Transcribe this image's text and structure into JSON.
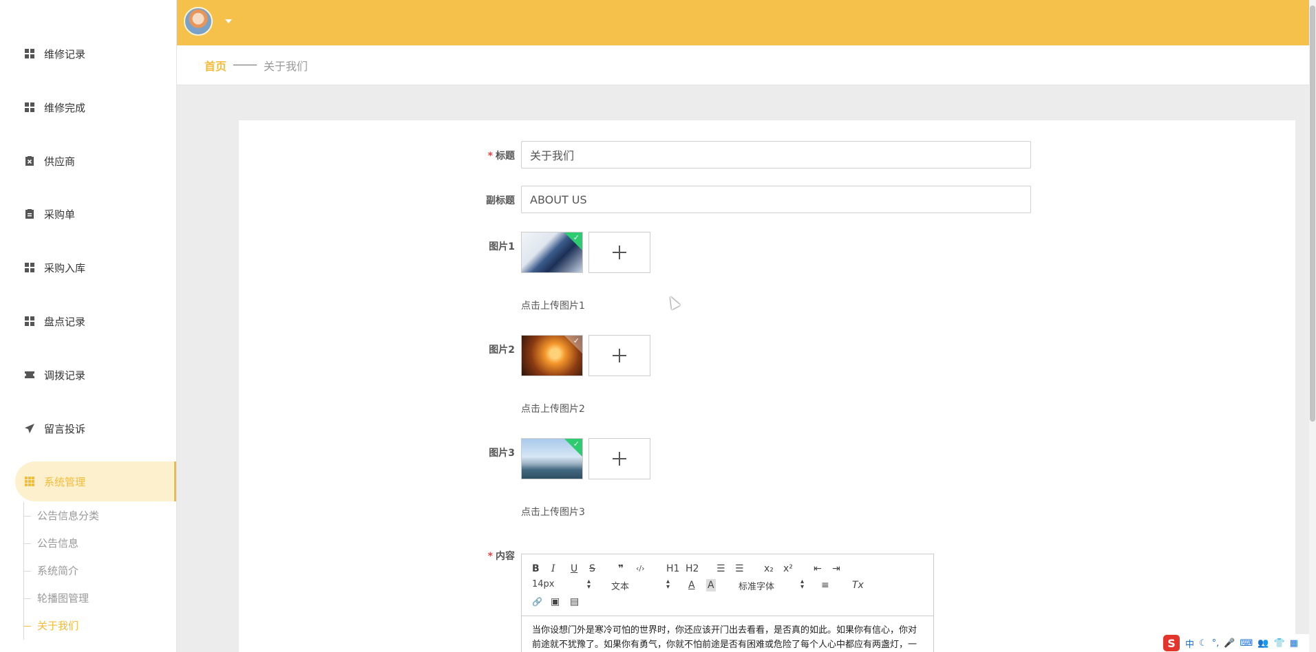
{
  "sidebar": {
    "items": [
      {
        "label": "维修记录",
        "icon": "grid-icon"
      },
      {
        "label": "维修完成",
        "icon": "grid-icon"
      },
      {
        "label": "供应商",
        "icon": "clipboard-x-icon"
      },
      {
        "label": "采购单",
        "icon": "clipboard-icon"
      },
      {
        "label": "采购入库",
        "icon": "grid-icon"
      },
      {
        "label": "盘点记录",
        "icon": "grid-icon"
      },
      {
        "label": "调拨记录",
        "icon": "ticket-icon"
      },
      {
        "label": "留言投诉",
        "icon": "paper-plane-icon"
      },
      {
        "label": "系统管理",
        "icon": "grid9-icon",
        "active": true
      }
    ],
    "sub_items": [
      {
        "label": "公告信息分类"
      },
      {
        "label": "公告信息"
      },
      {
        "label": "系统简介"
      },
      {
        "label": "轮播图管理"
      },
      {
        "label": "关于我们",
        "active": true
      }
    ]
  },
  "header": {
    "avatar": "user-avatar",
    "dropdown_icon": "caret-down-icon"
  },
  "breadcrumb": {
    "home": "首页",
    "current": "关于我们"
  },
  "form": {
    "title_label": "标题",
    "title_value": "关于我们",
    "subtitle_label": "副标题",
    "subtitle_value": "ABOUT US",
    "images": [
      {
        "label": "图片1",
        "hint": "点击上传图片1"
      },
      {
        "label": "图片2",
        "hint": "点击上传图片2"
      },
      {
        "label": "图片3",
        "hint": "点击上传图片3"
      }
    ],
    "content_label": "内容",
    "required_mark": "*"
  },
  "editor": {
    "toolbar": {
      "bold": "B",
      "italic": "I",
      "underline": "U",
      "strike": "S",
      "quote": "❞",
      "code": "‹/›",
      "h1": "H1",
      "h2": "H2",
      "ordered_list": "☰",
      "bullet_list": "☰",
      "subscript": "x₂",
      "superscript": "x²",
      "outdent": "⇤",
      "indent": "⇥",
      "size": "14px",
      "header": "文本",
      "color": "A",
      "background": "A",
      "font": "标准字体",
      "align": "≡",
      "clean": "Tx",
      "link": "🔗",
      "image": "▣",
      "video": "▤"
    },
    "text": "当你设想门外是寒冷可怕的世界时，你还应该开门出去看看，是否真的如此。如果你有信心，你对前途就不犹豫了。如果你有勇气，你就不怕前途是否有困难或危险了每个人心中都应有两盏灯，一"
  },
  "tray": [
    "中",
    "☾",
    "°,",
    "🎤",
    "⌨",
    "👥",
    "👕",
    "▦"
  ],
  "colors": {
    "accent": "#f4bb3a",
    "header_bg": "#f6c14a",
    "upload_success": "#2ecc71"
  }
}
